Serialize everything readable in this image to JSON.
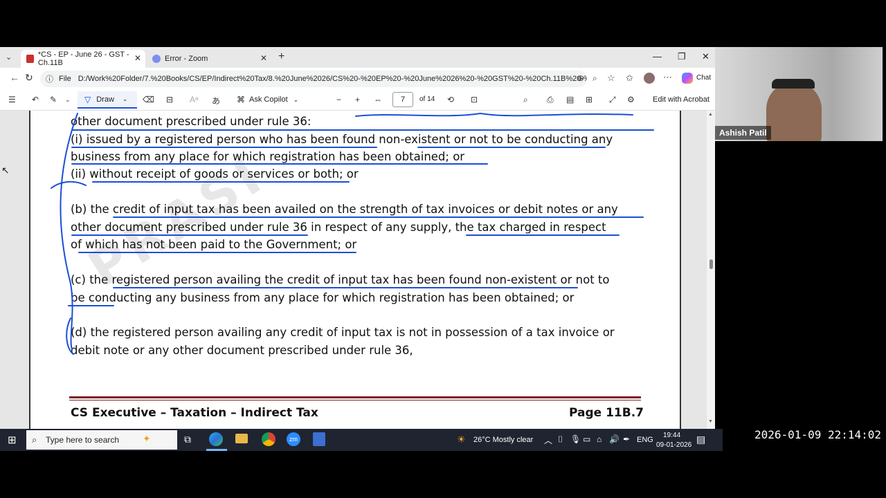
{
  "browser": {
    "tabs": [
      {
        "label": "*CS - EP - June 26 - GST - Ch.11B"
      },
      {
        "label": "Error - Zoom"
      }
    ],
    "new_tab": "+",
    "url_prefix": "File",
    "url": "D:/Work%20Folder/7.%20Books/CS/EP/Indirect%20Tax/8.%20June%2026/CS%20-%20EP%20-%20June%2026%20-%20GST%20-%20Ch.11B%20-%20Pat...",
    "chat_label": "Chat"
  },
  "pdf_toolbar": {
    "draw_label": "Draw",
    "ask_copilot_label": "Ask Copilot",
    "page_current": "7",
    "page_total": "of 14",
    "edit_acrobat_label": "Edit with Acrobat"
  },
  "document": {
    "lines": [
      "other document prescribed under rule 36:",
      "(i) issued by a registered person who has been found non-existent or not to be conducting any",
      "business from any place for which registration has been obtained; or",
      "(ii) without receipt of goods or services or both; or",
      "(b) the credit of input tax has been availed on the strength of tax invoices or debit notes or any",
      "other document prescribed under rule 36 in respect of any supply, the tax charged in respect",
      "of which has not been paid to the Government; or",
      "(c) the registered person availing the credit of input tax has been found non-existent or not to",
      "be conducting any business from any place for which registration has been obtained; or",
      "(d) the registered person availing any credit of input tax is not in possession of a tax invoice or",
      "debit note or any other document prescribed under rule 36,"
    ],
    "footer_left": "CS Executive – Taxation – Indirect Tax",
    "footer_right": "Page 11B.7"
  },
  "webcam": {
    "name": "Ashish Patil"
  },
  "taskbar": {
    "search_placeholder": "Type here to search",
    "weather": "26°C  Mostly clear",
    "language": "ENG",
    "time": "19:44",
    "date": "09-01-2026"
  },
  "overlay_timestamp": "2026-01-09  22:14:02",
  "colors": {
    "ink": "#1a4fd6",
    "footer_rule": "#7a1e1e"
  }
}
